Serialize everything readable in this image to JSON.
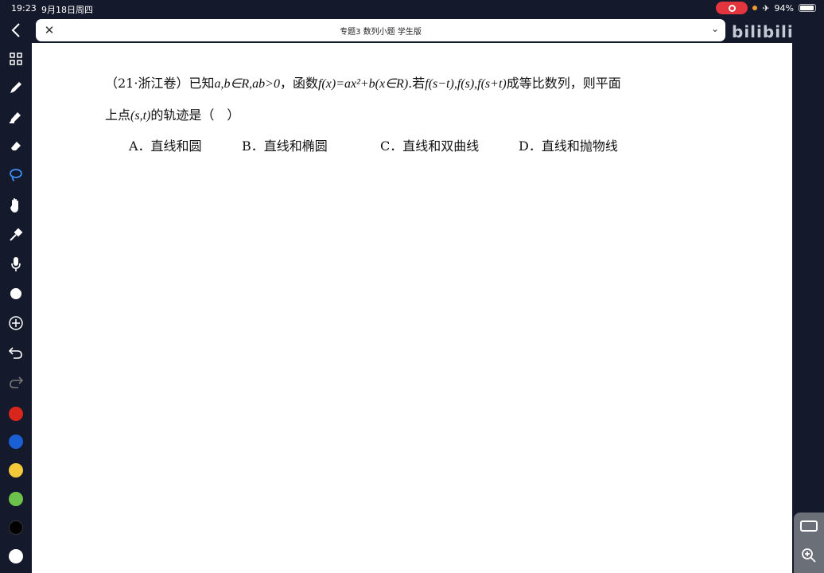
{
  "status_bar": {
    "time": "19:23",
    "date": "9月18日周四",
    "battery": "94%"
  },
  "tab": {
    "title": "专题3 数列小题 学生版",
    "close_icon": "close-icon",
    "chevron_icon": "chevron-down-icon"
  },
  "watermark": {
    "text": "bilibili"
  },
  "question": {
    "source": "（21·浙江卷）已知",
    "line1_math1": "a,b∈R,ab>0",
    "line1_text2": "，函数",
    "line1_math2": "f(x)=ax²+b(x∈R)",
    "line1_text3": ".若",
    "line1_math3": "f(s−t),f(s),f(s+t)",
    "line1_text4": "成等比数列，则平面",
    "line2_text1": "上点",
    "line2_math1": "(s,t)",
    "line2_text2": "的轨迹是（　）",
    "options": [
      "A．直线和圆",
      "B．直线和椭圆",
      "C．直线和双曲线",
      "D．直线和抛物线"
    ]
  },
  "sidebar": {
    "tools": [
      "back-icon",
      "grid-icon",
      "pen-icon",
      "highlighter-icon",
      "eraser-icon",
      "lasso-icon",
      "hand-icon",
      "pipette-icon",
      "mic-icon",
      "shape-icon",
      "add-icon",
      "undo-icon",
      "redo-icon"
    ],
    "colors": [
      "#d9261c",
      "#1a5fd6",
      "#f3c93a",
      "#6cc24a",
      "#000000",
      "#ffffff"
    ]
  }
}
